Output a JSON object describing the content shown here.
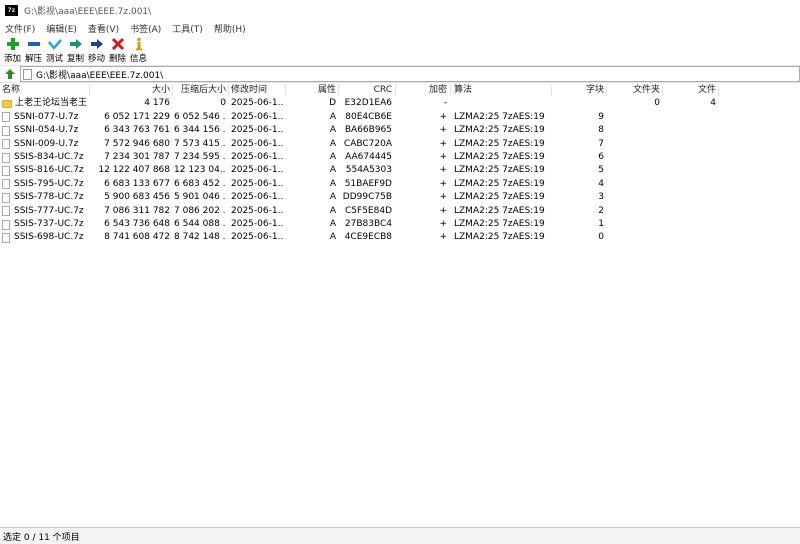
{
  "window": {
    "title": "G:\\影视\\aaa\\EEE\\EEE.7z.001\\",
    "app_icon_text": "7z"
  },
  "menu": [
    "文件(F)",
    "编辑(E)",
    "查看(V)",
    "书签(A)",
    "工具(T)",
    "帮助(H)"
  ],
  "toolbar": [
    {
      "label": "添加",
      "icon": "add-icon",
      "color": "#1aa31a"
    },
    {
      "label": "解压",
      "icon": "extract-icon",
      "color": "#2060c0"
    },
    {
      "label": "测试",
      "icon": "test-icon",
      "color": "#2aa6c8"
    },
    {
      "label": "复制",
      "icon": "copy-icon",
      "color": "#1c8f7a"
    },
    {
      "label": "移动",
      "icon": "move-icon",
      "color": "#1e3f9e"
    },
    {
      "label": "删除",
      "icon": "delete-icon",
      "color": "#d01a1a"
    },
    {
      "label": "信息",
      "icon": "info-icon",
      "color": "#c9a200"
    }
  ],
  "address": {
    "path": "G:\\影视\\aaa\\EEE\\EEE.7z.001\\"
  },
  "columns": {
    "name": "名称",
    "size": "大小",
    "packed": "压缩后大小",
    "modified": "修改时间",
    "attributes": "属性",
    "crc": "CRC",
    "encrypted": "加密",
    "method": "算法",
    "block": "字块",
    "folders": "文件夹",
    "files": "文件"
  },
  "rows": [
    {
      "type": "folder",
      "name": "上老王论坛当老王",
      "size": "4 176",
      "packed": "0",
      "modified": "2025-06-1...",
      "attributes": "D",
      "crc": "E32D1EA6",
      "encrypted": "-",
      "method": "",
      "block": "",
      "folders": "0",
      "files": "4"
    },
    {
      "type": "file",
      "name": "SSNI-077-U.7z",
      "size": "6 052 171 229",
      "packed": "6 052 546 ...",
      "modified": "2025-06-1...",
      "attributes": "A",
      "crc": "80E4CB6E",
      "encrypted": "+",
      "method": "LZMA2:25 7zAES:19",
      "block": "9",
      "folders": "",
      "files": ""
    },
    {
      "type": "file",
      "name": "SSNI-054-U.7z",
      "size": "6 343 763 761",
      "packed": "6 344 156 ...",
      "modified": "2025-06-1...",
      "attributes": "A",
      "crc": "BA66B965",
      "encrypted": "+",
      "method": "LZMA2:25 7zAES:19",
      "block": "8",
      "folders": "",
      "files": ""
    },
    {
      "type": "file",
      "name": "SSNI-009-U.7z",
      "size": "7 572 946 680",
      "packed": "7 573 415 ...",
      "modified": "2025-06-1...",
      "attributes": "A",
      "crc": "CABC720A",
      "encrypted": "+",
      "method": "LZMA2:25 7zAES:19",
      "block": "7",
      "folders": "",
      "files": ""
    },
    {
      "type": "file",
      "name": "SSIS-834-UC.7z",
      "size": "7 234 301 787",
      "packed": "7 234 595 ...",
      "modified": "2025-06-1...",
      "attributes": "A",
      "crc": "AA674445",
      "encrypted": "+",
      "method": "LZMA2:25 7zAES:19",
      "block": "6",
      "folders": "",
      "files": ""
    },
    {
      "type": "file",
      "name": "SSIS-816-UC.7z",
      "size": "12 122 407 868",
      "packed": "12 123 04...",
      "modified": "2025-06-1...",
      "attributes": "A",
      "crc": "554A5303",
      "encrypted": "+",
      "method": "LZMA2:25 7zAES:19",
      "block": "5",
      "folders": "",
      "files": ""
    },
    {
      "type": "file",
      "name": "SSIS-795-UC.7z",
      "size": "6 683 133 677",
      "packed": "6 683 452 ...",
      "modified": "2025-06-1...",
      "attributes": "A",
      "crc": "51BAEF9D",
      "encrypted": "+",
      "method": "LZMA2:25 7zAES:19",
      "block": "4",
      "folders": "",
      "files": ""
    },
    {
      "type": "file",
      "name": "SSIS-778-UC.7z",
      "size": "5 900 683 456",
      "packed": "5 901 046 ...",
      "modified": "2025-06-1...",
      "attributes": "A",
      "crc": "DD99C75B",
      "encrypted": "+",
      "method": "LZMA2:25 7zAES:19",
      "block": "3",
      "folders": "",
      "files": ""
    },
    {
      "type": "file",
      "name": "SSIS-777-UC.7z",
      "size": "7 086 311 782",
      "packed": "7 086 202 ...",
      "modified": "2025-06-1...",
      "attributes": "A",
      "crc": "C5F5E84D",
      "encrypted": "+",
      "method": "LZMA2:25 7zAES:19",
      "block": "2",
      "folders": "",
      "files": ""
    },
    {
      "type": "file",
      "name": "SSIS-737-UC.7z",
      "size": "6 543 736 648",
      "packed": "6 544 088 ...",
      "modified": "2025-06-1...",
      "attributes": "A",
      "crc": "27B83BC4",
      "encrypted": "+",
      "method": "LZMA2:25 7zAES:19",
      "block": "1",
      "folders": "",
      "files": ""
    },
    {
      "type": "file",
      "name": "SSIS-698-UC.7z",
      "size": "8 741 608 472",
      "packed": "8 742 148 ...",
      "modified": "2025-06-1...",
      "attributes": "A",
      "crc": "4CE9ECB8",
      "encrypted": "+",
      "method": "LZMA2:25 7zAES:19",
      "block": "0",
      "folders": "",
      "files": ""
    }
  ],
  "status": {
    "text": "选定 0 / 11 个项目"
  }
}
